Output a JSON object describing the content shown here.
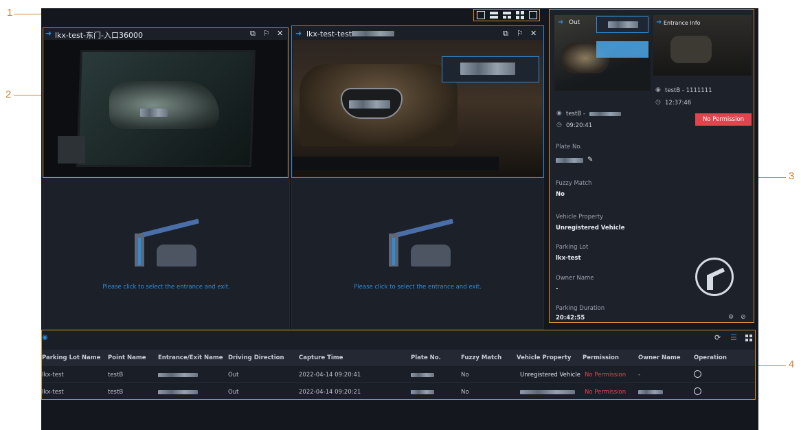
{
  "annotations": {
    "n1": "1",
    "n2": "2",
    "n3": "3",
    "n4": "4"
  },
  "toolbar": {
    "icons": [
      "single-layout-icon",
      "two-row-layout-icon",
      "four-split-layout-icon",
      "grid-layout-icon",
      "fullscreen-icon"
    ]
  },
  "cam1": {
    "title": "lkx-test-东门-入口36000"
  },
  "cam2": {
    "title": "lkx-test-testB-"
  },
  "empty": {
    "hint1": "Please click to select the entrance and exit.",
    "hint2": "Please click to select the entrance and exit."
  },
  "side": {
    "out_label": "Out",
    "entrance_label": "Entrance Info",
    "entrance_loc": "testB - 1111111",
    "entrance_time": "12:37:46",
    "exit_loc": "testB -",
    "exit_time": "09:20:41",
    "badge": "No Permission",
    "fields": [
      {
        "label": "Plate No.",
        "value": ""
      },
      {
        "label": "Fuzzy Match",
        "value": "No"
      },
      {
        "label": "Vehicle Property",
        "value": "Unregistered Vehicle"
      },
      {
        "label": "Parking Lot",
        "value": "lkx-test"
      },
      {
        "label": "Owner Name",
        "value": "-"
      },
      {
        "label": "Parking Duration",
        "value": "20:42:55"
      }
    ]
  },
  "table": {
    "headers": [
      "Parking Lot Name",
      "Point Name",
      "Entrance/Exit Name",
      "Driving Direction",
      "Capture Time",
      "Plate No.",
      "Fuzzy Match",
      "Vehicle Property",
      "Permission",
      "Owner Name",
      "Operation"
    ],
    "rows": [
      {
        "lot": "lkx-test",
        "point": "testB",
        "entrance": "",
        "dir": "Out",
        "time": "2022-04-14 09:20:41",
        "plate": "",
        "fuzzy": "No",
        "prop": "Unregistered Vehicle",
        "perm": "No Permission",
        "owner": "-"
      },
      {
        "lot": "lkx-test",
        "point": "testB",
        "entrance": "",
        "dir": "Out",
        "time": "2022-04-14 09:20:21",
        "plate": "",
        "fuzzy": "No",
        "prop": "",
        "perm": "No Permission",
        "owner": ""
      }
    ]
  },
  "colors": {
    "accent": "#d08a3a",
    "blue": "#2f8cd8",
    "danger": "#e0454e",
    "bg": "#14171d"
  }
}
